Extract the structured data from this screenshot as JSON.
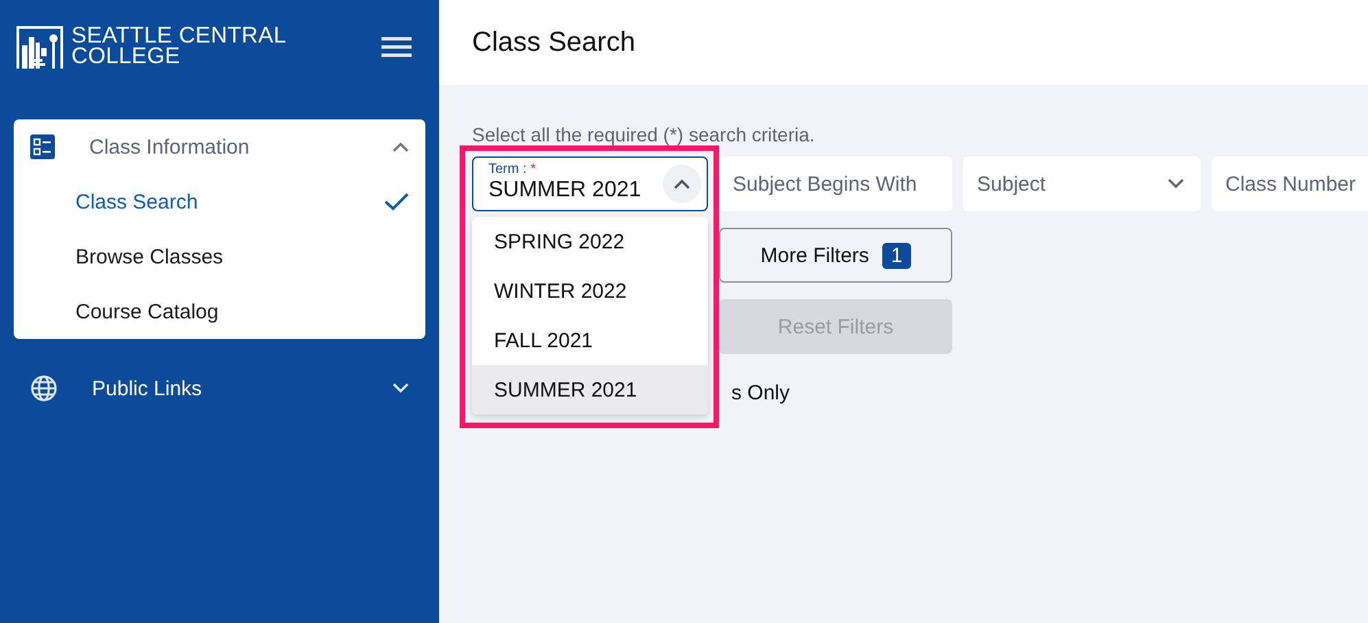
{
  "college": {
    "name_lines": [
      "SEATTLE CENTRAL",
      "COLLEGE"
    ]
  },
  "nav": [
    {
      "label": "Class Information",
      "expanded": true,
      "children": [
        {
          "label": "Class Search",
          "selected": true
        },
        {
          "label": "Browse Classes",
          "selected": false
        },
        {
          "label": "Course Catalog",
          "selected": false
        }
      ]
    },
    {
      "label": "Public Links",
      "expanded": false
    }
  ],
  "page_title": "Class Search",
  "instructions": "Select all the required (*) search criteria.",
  "term": {
    "label": "Term :",
    "required_mark": "*",
    "value": "SUMMER 2021",
    "expanded": true,
    "options": [
      {
        "label": "SPRING 2022",
        "selected": false
      },
      {
        "label": "WINTER 2022",
        "selected": false
      },
      {
        "label": "FALL 2021",
        "selected": false
      },
      {
        "label": "SUMMER 2021",
        "selected": true
      }
    ]
  },
  "fields": [
    {
      "kind": "text",
      "placeholder": "Subject Begins With"
    },
    {
      "kind": "select",
      "placeholder": "Subject"
    },
    {
      "kind": "text",
      "placeholder": "Class Number"
    }
  ],
  "more_filters": {
    "label": "More Filters",
    "count": "1"
  },
  "reset_filters": {
    "label": "Reset Filters",
    "disabled": true
  },
  "partial_text": "s Only"
}
